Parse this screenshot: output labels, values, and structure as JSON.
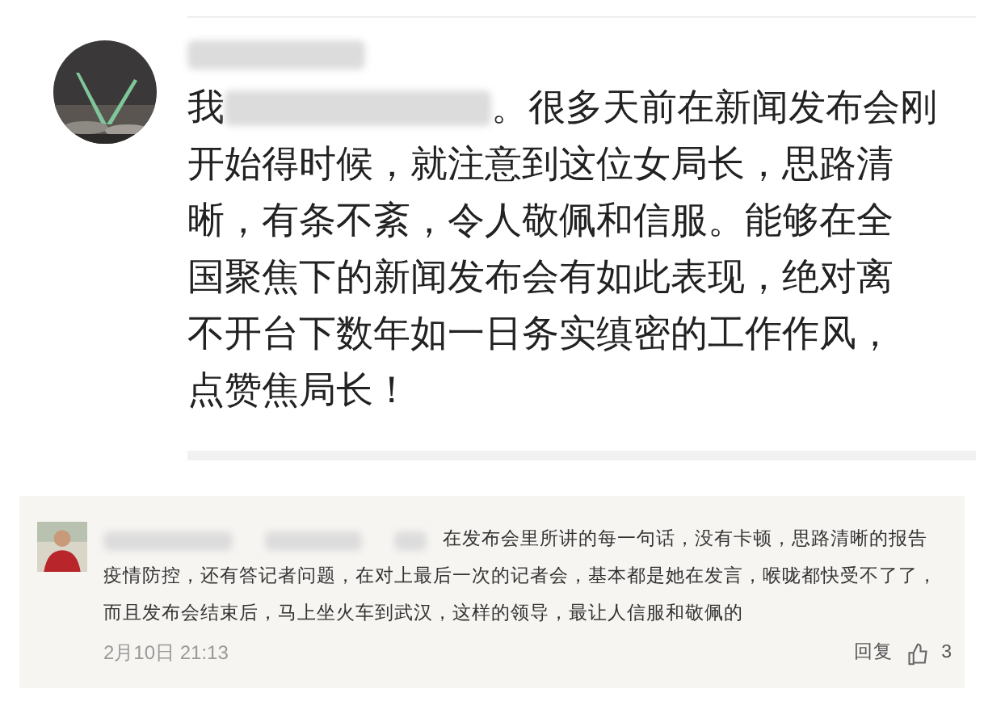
{
  "comments": [
    {
      "kind": "large",
      "lines": [
        "。很多天前在新闻发布会刚",
        "开始得时候，就注意到这位女局长，思路清",
        "晰，有条不紊，令人敬佩和信服。能够在全",
        "国聚焦下的新闻发布会有如此表现，绝对离",
        "不开台下数年如一日务实缜密的工作作风，",
        "点赞焦局长！"
      ],
      "prefix": "我"
    },
    {
      "kind": "small",
      "lines": [
        "在发布会里所讲的每一句话，没有卡顿，思路清晰的报告",
        "疫情防控，还有答记者问题，在对上最后一次的记者会，基本都是她在发言，喉咙都快受不了了，",
        "而且发布会结束后，马上坐火车到武汉，这样的领导，最让人信服和敬佩的"
      ],
      "time": "2月10日 21:13",
      "reply": "回复",
      "likes": "3"
    }
  ]
}
